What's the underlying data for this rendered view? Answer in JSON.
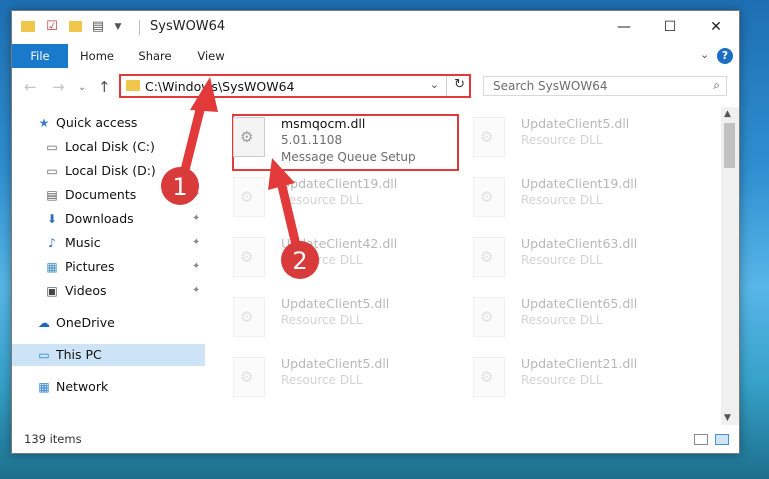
{
  "window": {
    "title": "SysWOW64",
    "controls": {
      "minimize": "—",
      "maximize": "☐",
      "close": "✕"
    }
  },
  "ribbon": {
    "tabs": [
      {
        "label": "File",
        "active": true
      },
      {
        "label": "Home"
      },
      {
        "label": "Share"
      },
      {
        "label": "View"
      }
    ],
    "expand_glyph": "⌄",
    "help_label": "?"
  },
  "nav": {
    "back": "←",
    "forward": "→",
    "recent": "⌄",
    "up": "↑",
    "address": "C:\\Windows\\SysWOW64",
    "address_dropdown": "⌄",
    "refresh": "↻",
    "search_placeholder": "Search SysWOW64",
    "search_icon": "⌕"
  },
  "sidebar": {
    "items": [
      {
        "label": "Quick access",
        "icon": "star-icon",
        "glyph": "★",
        "color": "#3d7cc9",
        "pinned": false
      },
      {
        "label": "Local Disk (C:)",
        "icon": "drive-icon",
        "glyph": "▭",
        "color": "#666666",
        "pinned": false
      },
      {
        "label": "Local Disk (D:)",
        "icon": "drive-icon",
        "glyph": "▭",
        "color": "#666666",
        "pinned": false
      },
      {
        "label": "Documents",
        "icon": "document-icon",
        "glyph": "▤",
        "color": "#555555",
        "pinned": true
      },
      {
        "label": "Downloads",
        "icon": "download-icon",
        "glyph": "⬇",
        "color": "#2a6cc0",
        "pinned": true
      },
      {
        "label": "Music",
        "icon": "music-icon",
        "glyph": "♪",
        "color": "#2a6cc0",
        "pinned": true
      },
      {
        "label": "Pictures",
        "icon": "pictures-icon",
        "glyph": "▦",
        "color": "#3f8dbd",
        "pinned": true
      },
      {
        "label": "Videos",
        "icon": "videos-icon",
        "glyph": "▣",
        "color": "#444444",
        "pinned": true
      },
      {
        "label": "OneDrive",
        "icon": "cloud-icon",
        "glyph": "☁",
        "color": "#1e66c4",
        "pinned": false
      },
      {
        "label": "This PC",
        "icon": "computer-icon",
        "glyph": "▭",
        "color": "#2a7fd0",
        "pinned": false,
        "selected": true
      },
      {
        "label": "Network",
        "icon": "network-icon",
        "glyph": "▦",
        "color": "#2a7fd0",
        "pinned": false
      }
    ],
    "pin_glyph": "📌"
  },
  "files": [
    {
      "name": "msmqocm.dll",
      "line2": "5.01.1108",
      "line3": "Message Queue Setup",
      "highlighted": true
    },
    {
      "name": "UpdateClient5.dll",
      "line2": "Resource DLL"
    },
    {
      "name": "UpdateClient19.dll",
      "line2": "Resource DLL"
    },
    {
      "name": "UpdateClient19.dll",
      "line2": "Resource DLL"
    },
    {
      "name": "UpdateClient42.dll",
      "line2": "Resource DLL"
    },
    {
      "name": "UpdateClient63.dll",
      "line2": "Resource DLL"
    },
    {
      "name": "UpdateClient5.dll",
      "line2": "Resource DLL"
    },
    {
      "name": "UpdateClient65.dll",
      "line2": "Resource DLL"
    },
    {
      "name": "UpdateClient5.dll",
      "line2": "Resource DLL"
    },
    {
      "name": "UpdateClient21.dll",
      "line2": "Resource DLL"
    }
  ],
  "status": {
    "item_count": "139 items"
  },
  "annotations": [
    {
      "label": "1",
      "color": "#d93a3a"
    },
    {
      "label": "2",
      "color": "#d93a3a"
    }
  ]
}
